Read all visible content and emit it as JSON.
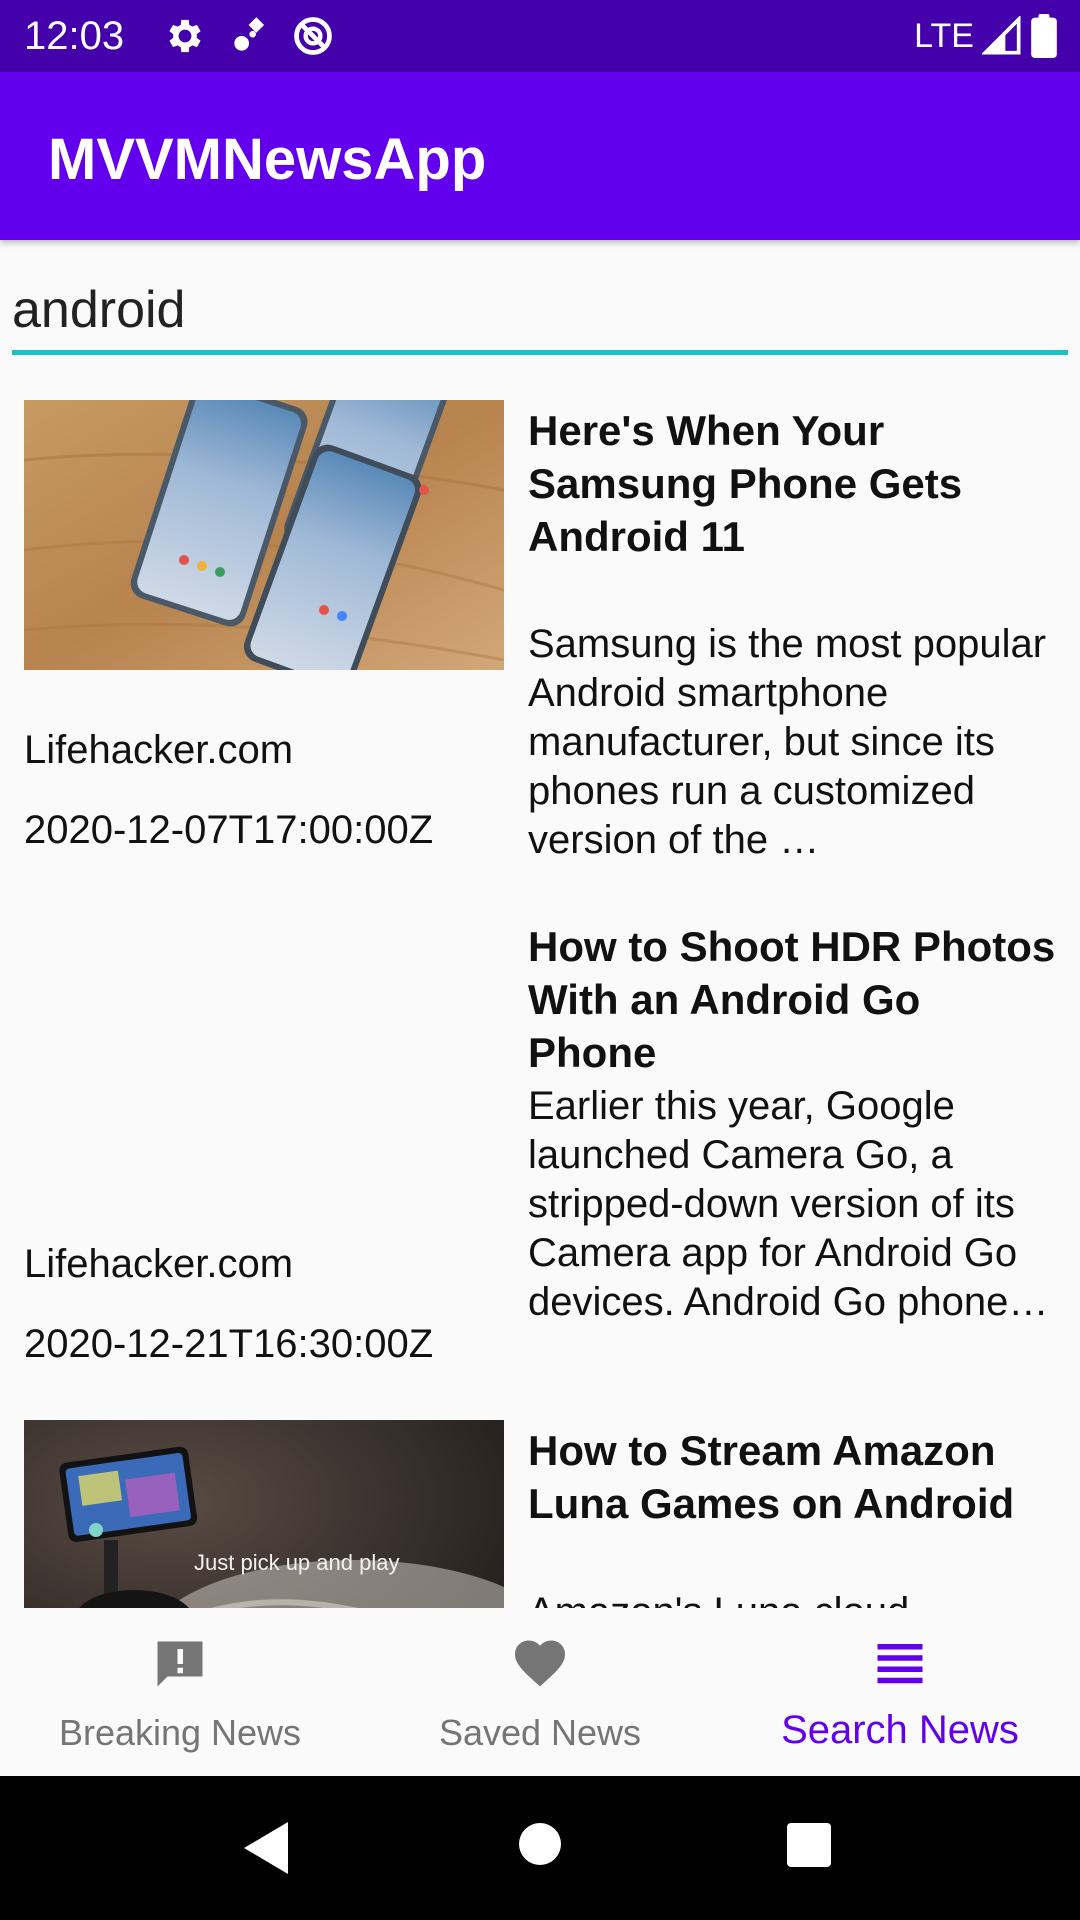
{
  "status_bar": {
    "time": "12:03",
    "network": "LTE",
    "icons": [
      "gear-icon",
      "satellite-icon",
      "no-sim-icon",
      "signal-icon",
      "battery-icon"
    ]
  },
  "app_bar": {
    "title": "MVVMNewsApp"
  },
  "search": {
    "value": "android",
    "underline_color": "#18c3c9"
  },
  "articles": [
    {
      "title": "Here's When Your Samsung Phone Gets Android 11",
      "description": "Samsung is the most popular Android smartphone manufacturer, but since its phones run a customized version of the …",
      "source": "Lifehacker.com",
      "published_at": "2020-12-07T17:00:00Z",
      "has_image": true
    },
    {
      "title": "How to Shoot HDR Photos With an Android Go Phone",
      "description": "Earlier this year, Google launched Camera Go, a stripped-down version of its Camera app for Android Go devices. Android Go phone…",
      "source": "Lifehacker.com",
      "published_at": "2020-12-21T16:30:00Z",
      "has_image": false
    },
    {
      "title": "How to Stream Amazon Luna Games on Android",
      "description": "Amazon's Luna cloud",
      "source": "",
      "published_at": "",
      "has_image": true,
      "image_caption": "Just pick up and play"
    }
  ],
  "bottom_nav": {
    "items": [
      {
        "label": "Breaking News",
        "icon": "alert-icon",
        "active": false
      },
      {
        "label": "Saved News",
        "icon": "heart-icon",
        "active": false
      },
      {
        "label": "Search News",
        "icon": "list-icon",
        "active": true
      }
    ],
    "active_color": "#6200ee",
    "inactive_color": "#757575"
  },
  "colors": {
    "primary": "#6200ee",
    "primary_dark": "#4400aa",
    "accent": "#18c3c9"
  }
}
